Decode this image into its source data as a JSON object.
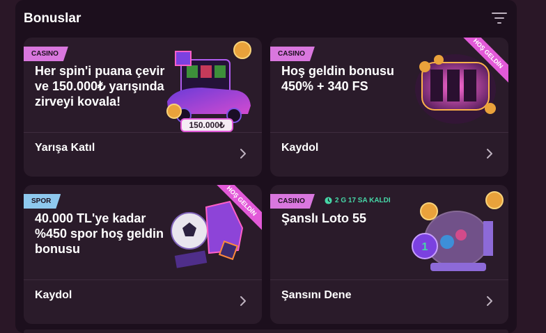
{
  "panel": {
    "title": "Bonuslar",
    "filter_icon": "filter-icon"
  },
  "cards": [
    {
      "badge": "CASINO",
      "title": "Her spin'i puana çevir ve 150.000₺ yarışında zirveyi kovala!",
      "art_label": "150.000₺",
      "action": "Yarışa Katıl"
    },
    {
      "badge": "CASINO",
      "title": "Hoş geldin bonusu 450% + 340 FS",
      "ribbon": "HOŞ GELDİN",
      "action": "Kaydol"
    },
    {
      "badge": "SPOR",
      "title": "40.000 TL'ye kadar %450 spor hoş geldin bonusu",
      "ribbon": "HOŞ GELDİN",
      "action": "Kaydol"
    },
    {
      "badge": "CASINO",
      "timer": "2 G 17 SA KALDI",
      "title": "Şanslı Loto 55",
      "action": "Şansını Dene"
    }
  ],
  "colors": {
    "background": "#2a1727",
    "panel": "#1c0f1d",
    "card": "#2a1b2a",
    "casino_badge": "#d977de",
    "spor_badge": "#8ec8ee",
    "timer": "#46d7a7",
    "ribbon": "#e25ad8"
  }
}
